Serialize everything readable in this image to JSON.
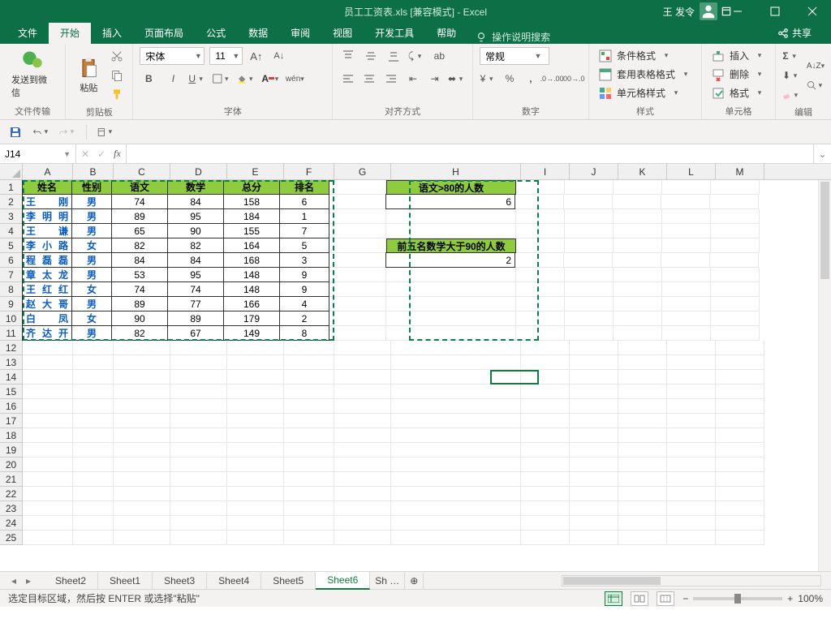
{
  "title": "员工工资表.xls  [兼容模式] - Excel",
  "user": "王 发令",
  "tabs": [
    "文件",
    "开始",
    "插入",
    "页面布局",
    "公式",
    "数据",
    "审阅",
    "视图",
    "开发工具",
    "帮助"
  ],
  "active_tab": 1,
  "tell_me": "操作说明搜索",
  "share": "共享",
  "ribbon": {
    "g1": {
      "label": "文件传输",
      "btn": "发送到微信"
    },
    "g2": {
      "label": "剪贴板",
      "btn": "粘贴"
    },
    "g3": {
      "label": "字体",
      "font": "宋体",
      "size": "11"
    },
    "g4": {
      "label": "对齐方式"
    },
    "g5": {
      "label": "数字",
      "format": "常规"
    },
    "g6": {
      "label": "样式",
      "a": "条件格式",
      "b": "套用表格格式",
      "c": "单元格样式"
    },
    "g7": {
      "label": "单元格",
      "a": "插入",
      "b": "删除",
      "c": "格式"
    },
    "g8": {
      "label": "编辑"
    }
  },
  "namebox": "J14",
  "columns": [
    "A",
    "B",
    "C",
    "D",
    "E",
    "F",
    "G",
    "H",
    "I",
    "J",
    "K",
    "L",
    "M"
  ],
  "headers": [
    "姓名",
    "性别",
    "语文",
    "数学",
    "总分",
    "排名"
  ],
  "h_msg1": "语文>80的人数",
  "h_val1": "6",
  "h_msg2": "前五名数学大于90的人数",
  "h_val2": "2",
  "rows": [
    {
      "name": "王　　刚",
      "sex": "男",
      "yw": "74",
      "sx": "84",
      "zf": "158",
      "pm": "6"
    },
    {
      "name": "李 明 明",
      "sex": "男",
      "yw": "89",
      "sx": "95",
      "zf": "184",
      "pm": "1"
    },
    {
      "name": "王　　谦",
      "sex": "男",
      "yw": "65",
      "sx": "90",
      "zf": "155",
      "pm": "7"
    },
    {
      "name": "李 小 路",
      "sex": "女",
      "yw": "82",
      "sx": "82",
      "zf": "164",
      "pm": "5"
    },
    {
      "name": "程 磊 磊",
      "sex": "男",
      "yw": "84",
      "sx": "84",
      "zf": "168",
      "pm": "3"
    },
    {
      "name": "章 太 龙",
      "sex": "男",
      "yw": "53",
      "sx": "95",
      "zf": "148",
      "pm": "9"
    },
    {
      "name": "王 红 红",
      "sex": "女",
      "yw": "74",
      "sx": "74",
      "zf": "148",
      "pm": "9"
    },
    {
      "name": "赵 大 哥",
      "sex": "男",
      "yw": "89",
      "sx": "77",
      "zf": "166",
      "pm": "4"
    },
    {
      "name": "白　　凤",
      "sex": "女",
      "yw": "90",
      "sx": "89",
      "zf": "179",
      "pm": "2"
    },
    {
      "name": "齐 达 开",
      "sex": "男",
      "yw": "82",
      "sx": "67",
      "zf": "149",
      "pm": "8"
    }
  ],
  "sheets": [
    "Sheet2",
    "Sheet1",
    "Sheet3",
    "Sheet4",
    "Sheet5",
    "Sheet6",
    "Sh …"
  ],
  "active_sheet": 5,
  "status_text": "选定目标区域，然后按 ENTER 或选择\"粘贴\"",
  "zoom": "100%",
  "chart_data": null
}
